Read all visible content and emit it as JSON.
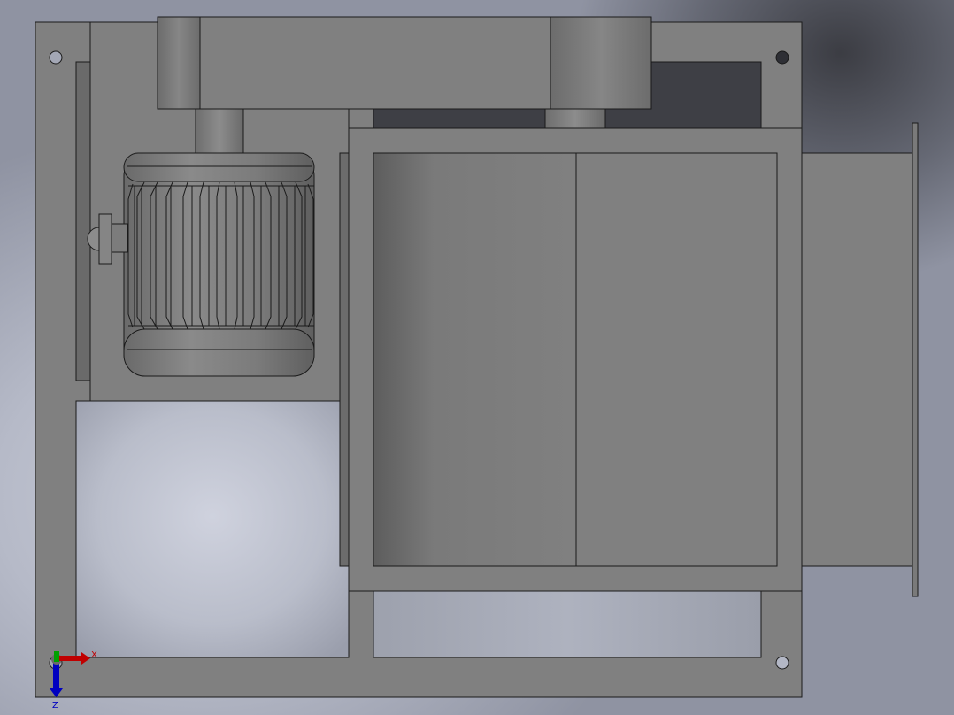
{
  "viewport": {
    "colors": {
      "body": "#808080",
      "edge": "#1a1a1a",
      "background_light": "#c9ccd8",
      "background_dark": "#8f93a2",
      "axis_x": "#c00000",
      "axis_y": "#00a000",
      "axis_z": "#0000c0"
    }
  },
  "triad": {
    "x_label": "X",
    "z_label": "Z"
  }
}
